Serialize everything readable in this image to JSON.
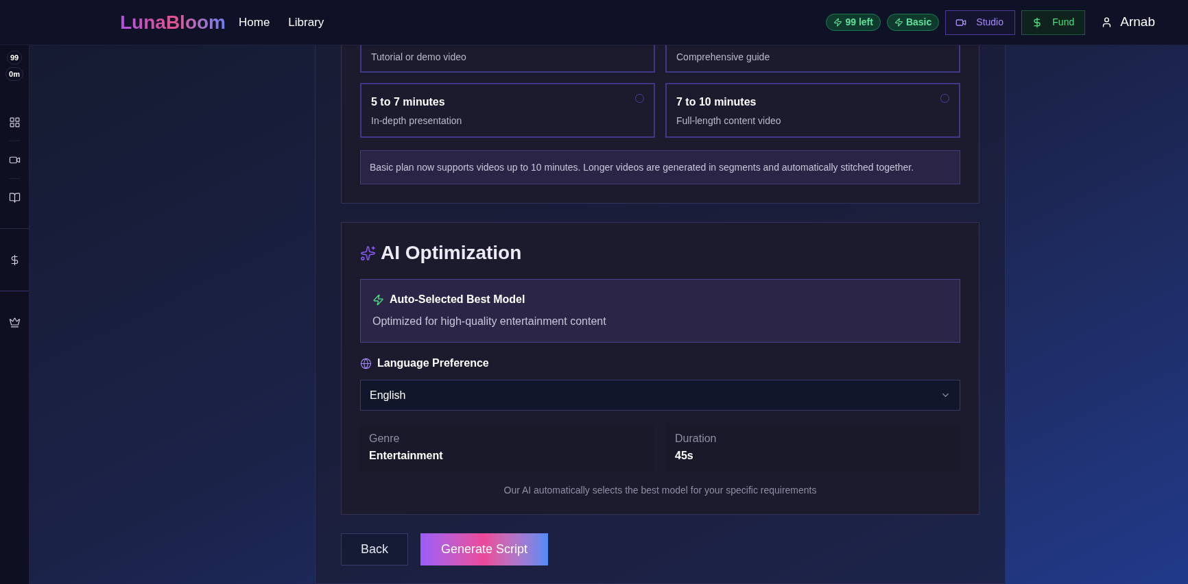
{
  "header": {
    "logo": "LunaBloom",
    "nav": [
      {
        "label": "Home"
      },
      {
        "label": "Library"
      }
    ],
    "badges": [
      {
        "label": "99 left"
      },
      {
        "label": "Basic"
      }
    ],
    "buttons": [
      {
        "label": "Studio",
        "kind": "studio"
      },
      {
        "label": "Fund",
        "kind": "fund"
      }
    ],
    "user": "Arnab"
  },
  "sidebar": {
    "counters": [
      "99",
      "0m"
    ],
    "items": [
      {
        "kind": "grid"
      },
      {
        "kind": "video"
      },
      {
        "kind": "book"
      },
      {
        "kind": "dollar"
      },
      {
        "kind": "crown"
      }
    ]
  },
  "duration_section": {
    "options_partial": [
      {
        "description": "Tutorial or demo video"
      },
      {
        "description": "Comprehensive guide"
      }
    ],
    "options": [
      {
        "title": "5 to 7 minutes",
        "description": "In-depth presentation",
        "selected": false
      },
      {
        "title": "7 to 10 minutes",
        "description": "Full-length content video",
        "selected": false
      }
    ],
    "note": "Basic plan now supports videos up to 10 minutes. Longer videos are generated in segments and automatically stitched together."
  },
  "ai_section": {
    "title": "AI Optimization",
    "model_card": {
      "title": "Auto-Selected Best Model",
      "description": "Optimized for high-quality entertainment content"
    },
    "language_label": "Language Preference",
    "language_value": "English",
    "summary": [
      {
        "label": "Genre",
        "value": "Entertainment"
      },
      {
        "label": "Duration",
        "value": "45s"
      }
    ],
    "footnote": "Our AI automatically selects the best model for your specific requirements"
  },
  "actions": {
    "back": "Back",
    "primary": "Generate Script"
  }
}
